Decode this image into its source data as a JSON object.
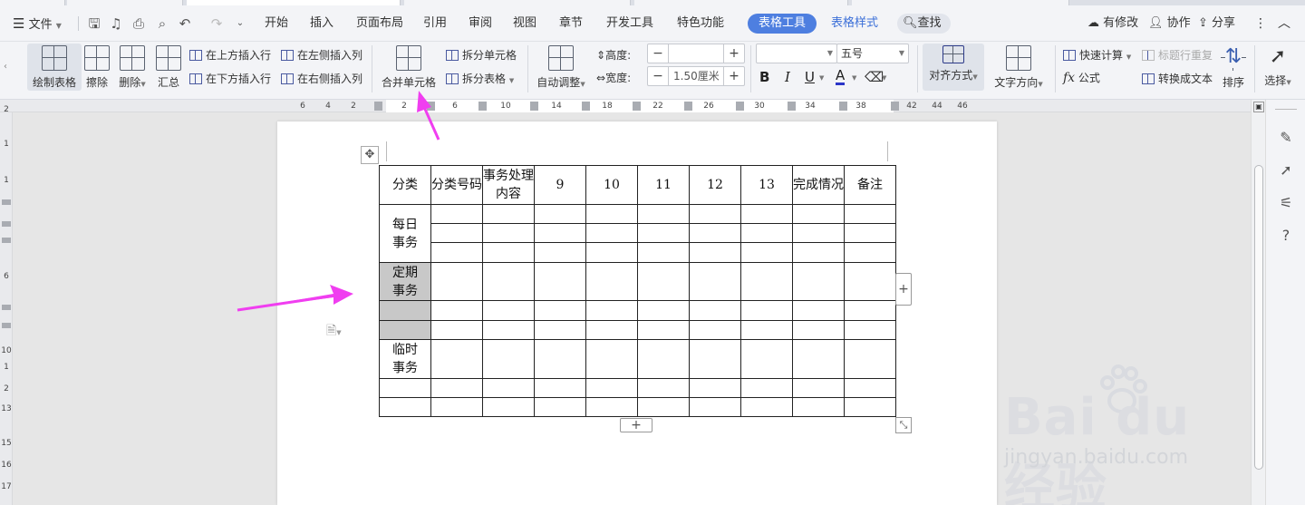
{
  "menubar": {
    "file_label": "文件",
    "tabs": [
      "开始",
      "插入",
      "页面布局",
      "引用",
      "审阅",
      "视图",
      "章节",
      "开发工具",
      "特色功能"
    ],
    "context_tab_active": "表格工具",
    "context_tab_2": "表格样式",
    "search_label": "查找",
    "right_items": [
      "有修改",
      "协作",
      "分享"
    ]
  },
  "ribbon": {
    "draw_table": "绘制表格",
    "erase": "擦除",
    "delete": "删除",
    "summary": "汇总",
    "insert_above": "在上方插入行",
    "insert_below": "在下方插入行",
    "insert_left": "在左侧插入列",
    "insert_right": "在右侧插入列",
    "merge_cells": "合并单元格",
    "split_cells": "拆分单元格",
    "split_table": "拆分表格",
    "auto_adjust": "自动调整",
    "height_label": "高度:",
    "height_value": "",
    "width_label": "宽度:",
    "width_value": "1.50厘米",
    "font_name": "",
    "font_size": "五号",
    "bold": "B",
    "italic": "I",
    "underline": "U",
    "font_color": "A",
    "align": "对齐方式",
    "text_dir": "文字方向",
    "quick_calc": "快速计算",
    "formula_fx": "fx",
    "formula": "公式",
    "repeat_header": "标题行重复",
    "to_text": "转换成文本",
    "sort": "排序",
    "select": "选择"
  },
  "hruler": {
    "labels": [
      "6",
      "4",
      "2",
      "2",
      "4",
      "6",
      "10",
      "14",
      "18",
      "22",
      "26",
      "30",
      "34",
      "38",
      "42",
      "44",
      "46"
    ]
  },
  "vruler": {
    "labels": [
      "2",
      "1",
      "1",
      "6",
      "10",
      "1",
      "2",
      "13",
      "15",
      "16",
      "17"
    ]
  },
  "table": {
    "header": [
      "分类",
      "分类号码",
      "事务处理内容",
      "9",
      "10",
      "11",
      "12",
      "13",
      "完成情况",
      "备注"
    ],
    "group_daily": "每日事务",
    "group_periodic": "定期事务",
    "group_temp": "临时事务"
  },
  "watermark": {
    "brand": "Bai du 经验",
    "url": "jingyan.baidu.com"
  },
  "colors": {
    "accent": "#4e7fe0",
    "arrow": "#f03ef0",
    "selected_cell": "#c8c8c8"
  }
}
